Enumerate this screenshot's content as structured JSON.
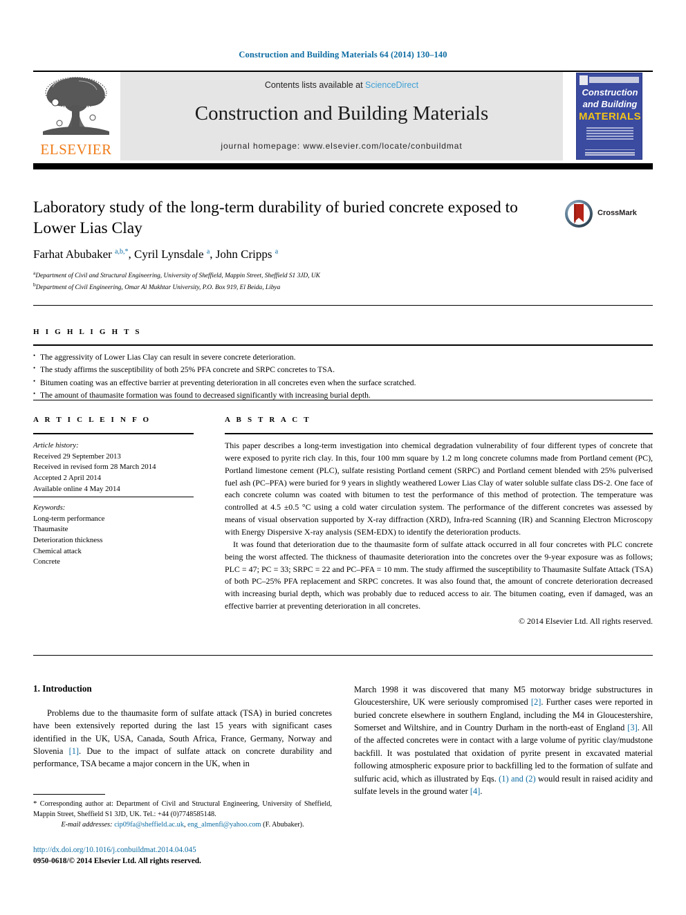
{
  "running_head": "Construction and Building Materials 64 (2014) 130–140",
  "header": {
    "contents_prefix": "Contents lists available at ",
    "sciencedirect": "ScienceDirect",
    "journal_title": "Construction and Building Materials",
    "homepage": "journal homepage: www.elsevier.com/locate/conbuildmat",
    "elsevier_wordmark": "ELSEVIER",
    "cover": {
      "line1": "Construction",
      "line2": "and Building",
      "line3": "MATERIALS"
    },
    "accent_blue": "#0b6ba2",
    "sciencedirect_blue": "#3d9fd4",
    "elsevier_orange": "#ef7d1a",
    "band_grey": "#e5e5e5"
  },
  "crossmark": {
    "label": "CrossMark"
  },
  "article": {
    "title": "Laboratory study of the long-term durability of buried concrete exposed to Lower Lias Clay",
    "authors_html": "Farhat Abubaker <sup>a,b,</sup><sup>*</sup>, Cyril Lynsdale <sup>a</sup>, John Cripps <sup>a</sup>",
    "affiliations": [
      {
        "marker": "a",
        "text": "Department of Civil and Structural Engineering, University of Sheffield, Mappin Street, Sheffield S1 3JD, UK"
      },
      {
        "marker": "b",
        "text": "Department of Civil Engineering, Omar Al Mukhtar University, P.O. Box 919, El Beida, Libya"
      }
    ]
  },
  "highlights": {
    "heading": "H I G H L I G H T S",
    "items": [
      "The aggressivity of Lower Lias Clay can result in severe concrete deterioration.",
      "The study affirms the susceptibility of both 25% PFA concrete and SRPC concretes to TSA.",
      "Bitumen coating was an effective barrier at preventing deterioration in all concretes even when the surface scratched.",
      "The amount of thaumasite formation was found to decreased significantly with increasing burial depth."
    ]
  },
  "article_info": {
    "heading": "A R T I C L E  I N F O",
    "history_label": "Article history:",
    "history": [
      "Received 29 September 2013",
      "Received in revised form 28 March 2014",
      "Accepted 2 April 2014",
      "Available online 4 May 2014"
    ],
    "keywords_label": "Keywords:",
    "keywords": [
      "Long-term performance",
      "Thaumasite",
      "Deterioration thickness",
      "Chemical attack",
      "Concrete"
    ]
  },
  "abstract": {
    "heading": "A B S T R A C T",
    "paragraph1": "This paper describes a long-term investigation into chemical degradation vulnerability of four different types of concrete that were exposed to pyrite rich clay. In this, four 100 mm square by 1.2 m long concrete columns made from Portland cement (PC), Portland limestone cement (PLC), sulfate resisting Portland cement (SRPC) and Portland cement blended with 25% pulverised fuel ash (PC–PFA) were buried for 9 years in slightly weathered Lower Lias Clay of water soluble sulfate class DS-2. One face of each concrete column was coated with bitumen to test the performance of this method of protection. The temperature was controlled at 4.5 ±0.5 °C using a cold water circulation system. The performance of the different concretes was assessed by means of visual observation supported by X-ray diffraction (XRD), Infra-red Scanning (IR) and Scanning Electron Microscopy with Energy Dispersive X-ray analysis (SEM-EDX) to identify the deterioration products.",
    "paragraph2": "It was found that deterioration due to the thaumasite form of sulfate attack occurred in all four concretes with PLC concrete being the worst affected. The thickness of thaumasite deterioration into the concretes over the 9-year exposure was as follows; PLC = 47; PC = 33; SRPC = 22 and PC–PFA = 10 mm. The study affirmed the susceptibility to Thaumasite Sulfate Attack (TSA) of both PC–25% PFA replacement and SRPC concretes. It was also found that, the amount of concrete deterioration decreased with increasing burial depth, which was probably due to reduced access to air. The bitumen coating, even if damaged, was an effective barrier at preventing deterioration in all concretes.",
    "copyright": "© 2014 Elsevier Ltd. All rights reserved."
  },
  "introduction": {
    "heading": "1. Introduction",
    "left_column_html": "Problems due to the thaumasite form of sulfate attack (TSA) in buried concretes have been extensively reported during the last 15 years with significant cases identified in the UK, USA, Canada, South Africa, France, Germany, Norway and Slovenia <span class=\"ref\">[1]</span>. Due to the impact of sulfate attack on concrete durability and performance, TSA became a major concern in the UK, when in",
    "right_column_html": "March 1998 it was discovered that many M5 motorway bridge substructures in Gloucestershire, UK were seriously compromised <span class=\"ref\">[2]</span>. Further cases were reported in buried concrete elsewhere in southern England, including the M4 in Gloucestershire, Somerset and Wiltshire, and in Country Durham in the north-east of England <span class=\"ref\">[3]</span>. All of the affected concretes were in contact with a large volume of pyritic clay/mudstone backfill. It was postulated that oxidation of pyrite present in excavated material following atmospheric exposure prior to backfilling led to the formation of sulfate and sulfuric acid, which as illustrated by Eqs. <span class=\"ref\">(1) and (2)</span> would result in raised acidity and sulfate levels in the ground water <span class=\"ref\">[4]</span>."
  },
  "footnote": {
    "corresponding_html": "<span style=\"font-size:11px\">*</span> Corresponding author at: Department of Civil and Structural Engineering, University of Sheffield, Mappin Street, Sheffield S1 3JD, UK. Tel.: +44 (0)7748585148.",
    "email_label": "E-mail addresses:",
    "emails_html": "<span class=\"link\">cip09fa@sheffield.ac.uk</span>, <span class=\"link\">eng_almenfi@yahoo.com</span> (F. Abubaker)."
  },
  "doi": {
    "url": "http://dx.doi.org/10.1016/j.conbuildmat.2014.04.045",
    "issn_line": "0950-0618/© 2014 Elsevier Ltd. All rights reserved."
  }
}
